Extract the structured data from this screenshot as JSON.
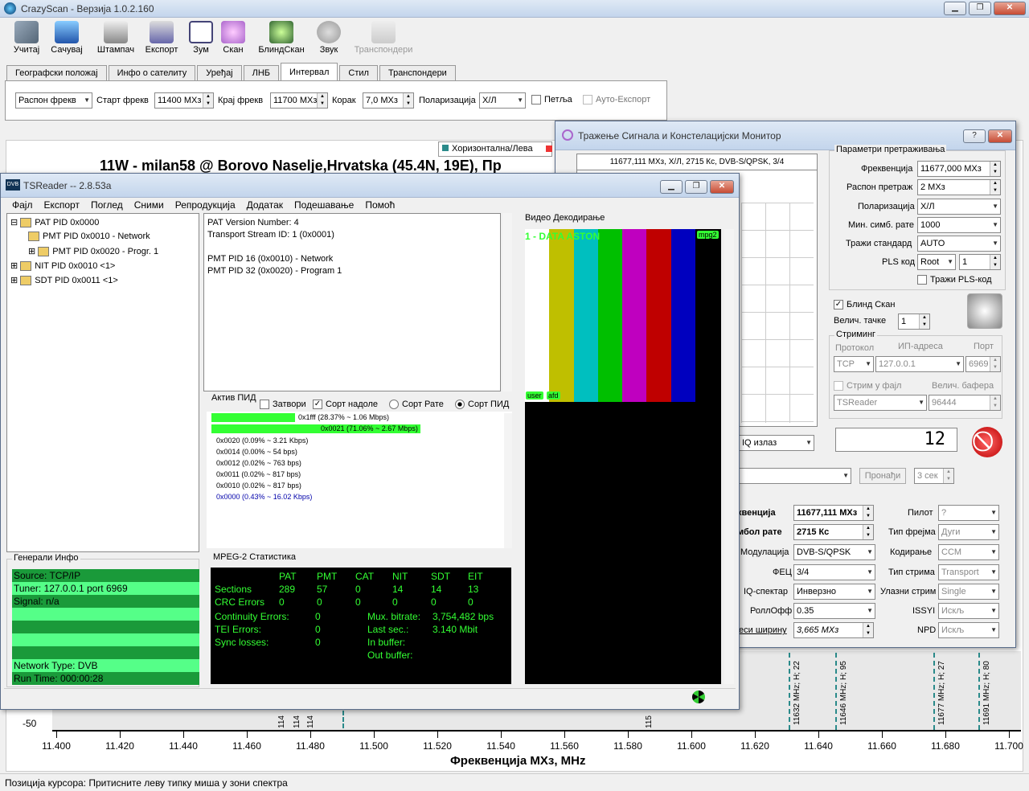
{
  "app": {
    "title": "CrazyScan - Верзија 1.0.2.160"
  },
  "toolbar": [
    {
      "label": "Учитај"
    },
    {
      "label": "Сачувај"
    },
    {
      "label": "Штампач"
    },
    {
      "label": "Експорт"
    },
    {
      "label": "Зум"
    },
    {
      "label": "Скан"
    },
    {
      "label": "БлиндСкан"
    },
    {
      "label": "Звук"
    },
    {
      "label": "Транспондери"
    }
  ],
  "tabs": [
    "Географски положај",
    "Инфо о сателиту",
    "Уређај",
    "ЛНБ",
    "Интервал",
    "Стил",
    "Транспондери"
  ],
  "interval": {
    "mode": "Распон фрекв",
    "start_label": "Старт фрекв",
    "start": "11400 МХз",
    "end_label": "Крај фрекв",
    "end": "11700 МХз",
    "step_label": "Корак",
    "step": "7,0 МХз",
    "pol_label": "Поларизација",
    "pol": "Х/Л",
    "loop": "Петља",
    "auto_export": "Ауто-Експорт"
  },
  "spectrum": {
    "legend": "Хоризонтална/Лева",
    "title": "11W - milan58 @ Borovo Naselje,Hrvatska (45.4N, 19E), Пр",
    "ymin_label": "-50",
    "xlabel": "Фреквенција  МХз, MHz",
    "xticks": [
      "11.400",
      "11.420",
      "11.440",
      "11.460",
      "11.480",
      "11.500",
      "11.520",
      "11.540",
      "11.560",
      "11.580",
      "11.600",
      "11.620",
      "11.640",
      "11.660",
      "11.680",
      "11.700"
    ],
    "markers": [
      "11632 MHz; H; 22",
      "11646 MHz; H; 95",
      "11677 MHz; H; 27",
      "11691 MHz; H; 80"
    ],
    "small_markers": [
      "114",
      "114",
      "114",
      "115"
    ]
  },
  "status": "Позиција курсора: Притисните леву типку миша у зони спектра",
  "tsreader": {
    "title": "TSReader -- 2.8.53a",
    "menu": [
      "Фајл",
      "Експорт",
      "Поглед",
      "Сними",
      "Репродукција",
      "Додатак",
      "Подешавање",
      "Помоћ"
    ],
    "tree": [
      "PAT PID 0x0000",
      "PMT PID 0x0010 - Network",
      "PMT PID 0x0020 - Progr. 1",
      "NIT PID 0x0010 <1>",
      "SDT PID 0x0011 <1>"
    ],
    "detail": [
      "PAT Version Number: 4",
      "Transport Stream ID: 1 (0x0001)",
      "",
      "PMT PID 16 (0x0010) - Network",
      "PMT PID 32 (0x0020) - Program 1"
    ],
    "video_label": "Видео Декодирање",
    "video_overlay": "1 - DATA ASTON",
    "video_tag": "mpg2",
    "video_tags_bottom": [
      "user",
      "afd"
    ],
    "active_pid": "Актив ПИД",
    "close_chk": "Затвори",
    "sort_top": "Сорт надоле",
    "sort_rate": "Сорт Рате",
    "sort_pid": "Сорт ПИД",
    "pids": [
      {
        "text": "0x1fff (28.37% ~ 1.06 Mbps)",
        "pct": 0.2837
      },
      {
        "text": "0x0021 (71.06% ~ 2.67 Mbps)",
        "pct": 0.7106
      },
      {
        "text": "0x0020 (0.09% ~ 3.21 Kbps)",
        "pct": 0
      },
      {
        "text": "0x0014 (0.00% ~ 54 bps)",
        "pct": 0
      },
      {
        "text": "0x0012 (0.02% ~ 763 bps)",
        "pct": 0
      },
      {
        "text": "0x0011 (0.02% ~ 817 bps)",
        "pct": 0
      },
      {
        "text": "0x0010 (0.02% ~ 817 bps)",
        "pct": 0
      },
      {
        "text": "0x0000 (0.43% ~ 16.02 Kbps)",
        "pct": 0
      }
    ],
    "general_label": "Генерали Инфо",
    "general": [
      "Source: TCP/IP",
      "Tuner: 127.0.0.1 port 6969",
      "Signal: n/a",
      "",
      "",
      "",
      "",
      "Network Type: DVB",
      "Run Time: 000:00:28"
    ],
    "mpeg_label": "MPEG-2 Статистика",
    "mpeg_headers": [
      "PAT",
      "PMT",
      "CAT",
      "NIT",
      "SDT",
      "EIT"
    ],
    "sections": {
      "label": "Sections",
      "values": [
        "289",
        "57",
        "0",
        "14",
        "14",
        "13"
      ]
    },
    "crc": {
      "label": "CRC Errors",
      "values": [
        "0",
        "0",
        "0",
        "0",
        "0",
        "0"
      ]
    },
    "cont": {
      "label": "Continuity Errors:",
      "value": "0"
    },
    "tei": {
      "label": "TEI Errors:",
      "value": "0"
    },
    "sync": {
      "label": "Sync losses:",
      "value": "0"
    },
    "mux": {
      "label": "Mux. bitrate:",
      "value": "3,754,482 bps"
    },
    "last": {
      "label": "Last sec.:",
      "value": "3.140 Mbit"
    },
    "inbuf": "In buffer:",
    "outbuf": "Out buffer:"
  },
  "monitor": {
    "title": "Тражење Сигнала и Констелацијски Монитор",
    "const_title": "11677,111 МХз, Х/Л, 2715 Кс, DVB-S/QPSK, 3/4",
    "params_label": "Параметри претраживања",
    "freq_label": "Фреквенција",
    "freq": "11677,000 МХз",
    "range_label": "Распон претраж",
    "range": "2 МХз",
    "pol_label": "Поларизација",
    "pol": "Х/Л",
    "minsym_label": "Мин. симб. рате",
    "minsym": "1000",
    "std_label": "Тражи стандард",
    "std": "AUTO",
    "pls_label": "PLS код",
    "pls": "Root",
    "pls_num": "1",
    "pls_search": "Тражи PLS-код",
    "blind": "Блинд Скан",
    "dot_label": "Велич. тачке",
    "dot": "1",
    "stream_label": "Стриминг",
    "proto_label": "Протокол",
    "ip_label": "ИП-адреса",
    "port_label": "Порт",
    "proto": "TCP",
    "ip": "127.0.0.1",
    "port": "6969",
    "tofile": "Стрим у фајл",
    "buf_label": "Велич. бафера",
    "app": "TSReader",
    "buf": "96444",
    "iq": "IQ излаз",
    "counter": "12",
    "find": "Пронађи",
    "sec": "3 сек",
    "rfreq_label": "квенција",
    "rfreq": "11677,111 МХз",
    "sr_label": "мбол рате",
    "sr": "2715 Кс",
    "mod_label": "Модулација",
    "mod": "DVB-S/QPSK",
    "fec_label": "ФЕЦ",
    "fec": "3/4",
    "iqspec_label": "IQ-спектар",
    "iqspec": "Инверзно",
    "roll_label": "РоллОфф",
    "roll": "0.35",
    "bw_label": "еси ширину",
    "bw": "3,665 МХз",
    "pilot_label": "Пилот",
    "pilot": "?",
    "frame_label": "Тип фрејма",
    "frame": "Дуги",
    "code_label": "Кодирање",
    "code": "CCM",
    "stype_label": "Тип стрима",
    "stype": "Transport",
    "instream_label": "Улазни стрим",
    "instream": "Single",
    "issyi_label": "ISSYI",
    "issyi": "Искљ",
    "npd_label": "NPD",
    "npd": "Искљ"
  }
}
